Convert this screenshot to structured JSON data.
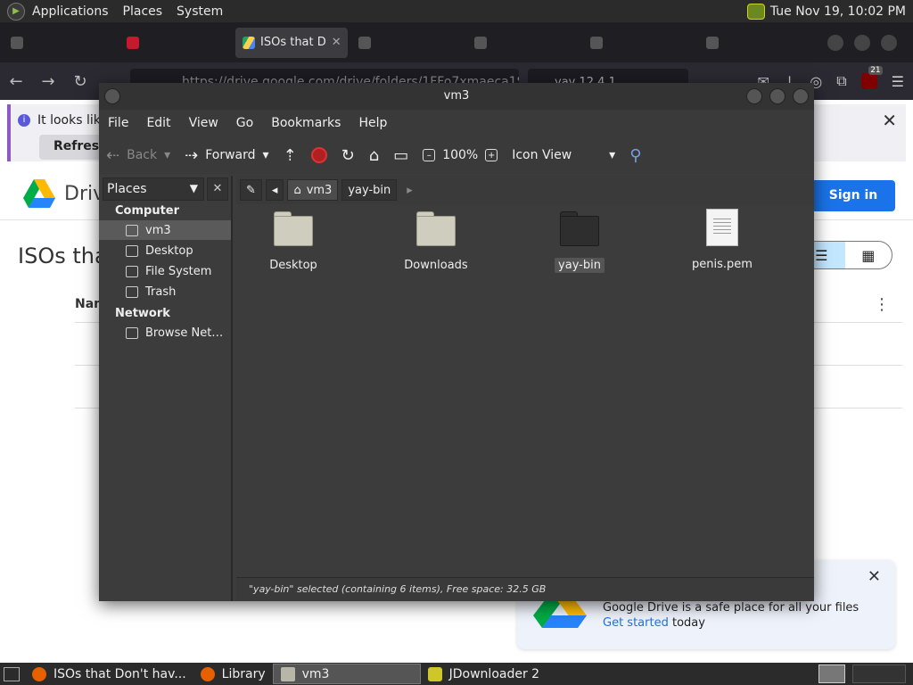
{
  "top_panel": {
    "menus": [
      "Applications",
      "Places",
      "System"
    ],
    "clock": "Tue Nov 19, 10:02 PM"
  },
  "browser": {
    "active_tab_title": "ISOs that D",
    "url": "https://drive.google.com/drive/folders/1FFo7xmaeca1S",
    "extension_text": "yay 12.4.1",
    "ublock_badge": "21",
    "infobar_text": "It looks like",
    "refresh_label": "Refresh F",
    "drive_brand": "Drive",
    "sign_in_label": "Sign in",
    "folder_title": "ISOs tha",
    "column_name": "Nam",
    "promo_message": "Google Drive is a safe place for all your files",
    "promo_link": "Get started",
    "promo_suffix": " today"
  },
  "caja": {
    "title": "vm3",
    "menu": [
      "File",
      "Edit",
      "View",
      "Go",
      "Bookmarks",
      "Help"
    ],
    "toolbar": {
      "back": "Back",
      "forward": "Forward",
      "zoom": "100%",
      "view_mode": "Icon View"
    },
    "sidebar": {
      "selector": "Places",
      "computer_heading": "Computer",
      "network_heading": "Network",
      "items": [
        "vm3",
        "Desktop",
        "File System",
        "Trash"
      ],
      "network_items": [
        "Browse Net…"
      ]
    },
    "path": [
      "vm3",
      "yay-bin"
    ],
    "files": [
      {
        "name": "Desktop",
        "kind": "folder-light"
      },
      {
        "name": "Downloads",
        "kind": "folder-light"
      },
      {
        "name": "yay-bin",
        "kind": "folder-dark"
      },
      {
        "name": "penis.pem",
        "kind": "file"
      }
    ],
    "status": "\"yay-bin\" selected (containing 6 items), Free space: 32.5 GB"
  },
  "taskbar": {
    "tasks": [
      "ISOs that Don't hav...",
      "Library",
      "vm3",
      "JDownloader 2"
    ]
  },
  "colors": {
    "accent": "#1a73e8",
    "window_bg": "#3c3c3c"
  }
}
